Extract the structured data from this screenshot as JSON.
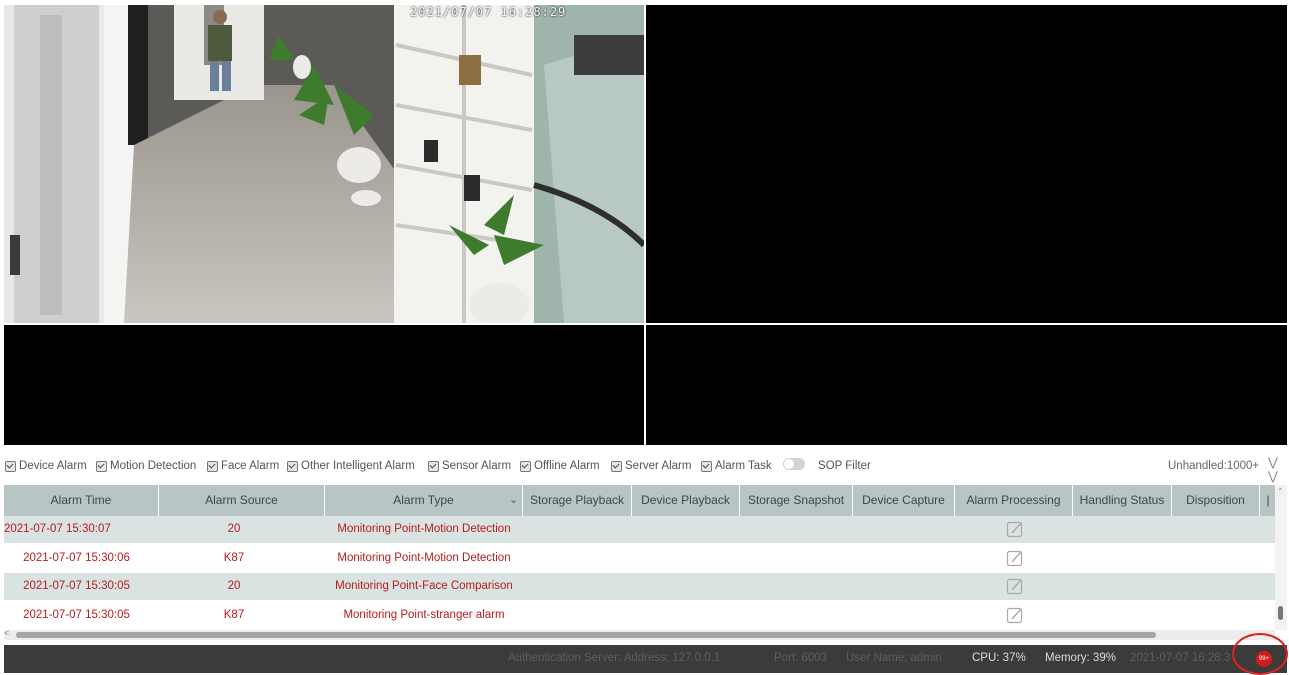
{
  "video": {
    "osd_timestamp": "2021/07/07  16:28:29"
  },
  "filters": [
    {
      "label": "Device Alarm",
      "checked": true
    },
    {
      "label": "Motion Detection",
      "checked": true
    },
    {
      "label": "Face Alarm",
      "checked": true
    },
    {
      "label": "Other Intelligent Alarm",
      "checked": true
    },
    {
      "label": "Sensor Alarm",
      "checked": true
    },
    {
      "label": "Offline Alarm",
      "checked": true
    },
    {
      "label": "Server Alarm",
      "checked": true
    },
    {
      "label": "Alarm Task",
      "checked": true
    }
  ],
  "sop_filter": {
    "label": "SOP Filter",
    "on": false
  },
  "unhandled": "Unhandled:1000+",
  "table": {
    "headers": [
      "Alarm Time",
      "Alarm Source",
      "Alarm Type",
      "Storage Playback",
      "Device Playback",
      "Storage Snapshot",
      "Device Capture",
      "Alarm Processing",
      "Handling Status",
      "Disposition"
    ],
    "rows": [
      {
        "time": "2021-07-07 15:30:07",
        "source": "20",
        "type": "Monitoring Point-Motion Detection"
      },
      {
        "time": "2021-07-07 15:30:06",
        "source": "K87",
        "type": "Monitoring Point-Motion Detection"
      },
      {
        "time": "2021-07-07 15:30:05",
        "source": "20",
        "type": "Monitoring Point-Face Comparison"
      },
      {
        "time": "2021-07-07 15:30:05",
        "source": "K87",
        "type": "Monitoring Point-stranger alarm"
      }
    ]
  },
  "status": {
    "auth_server": "Authentication Server: Address: 127.0.0.1",
    "port": "Port: 6003",
    "user": "User Name: admin",
    "cpu": "CPU: 37%",
    "memory": "Memory: 39%",
    "datetime": "2021-07-07 16:28:3",
    "badge": "99+"
  },
  "colors": {
    "alarm_text": "#b71c1c",
    "header_bg": "#b8c5c5",
    "alt_row_bg": "#d9e3e2",
    "status_bg": "#3b3b3b",
    "badge": "#d21b1b"
  }
}
